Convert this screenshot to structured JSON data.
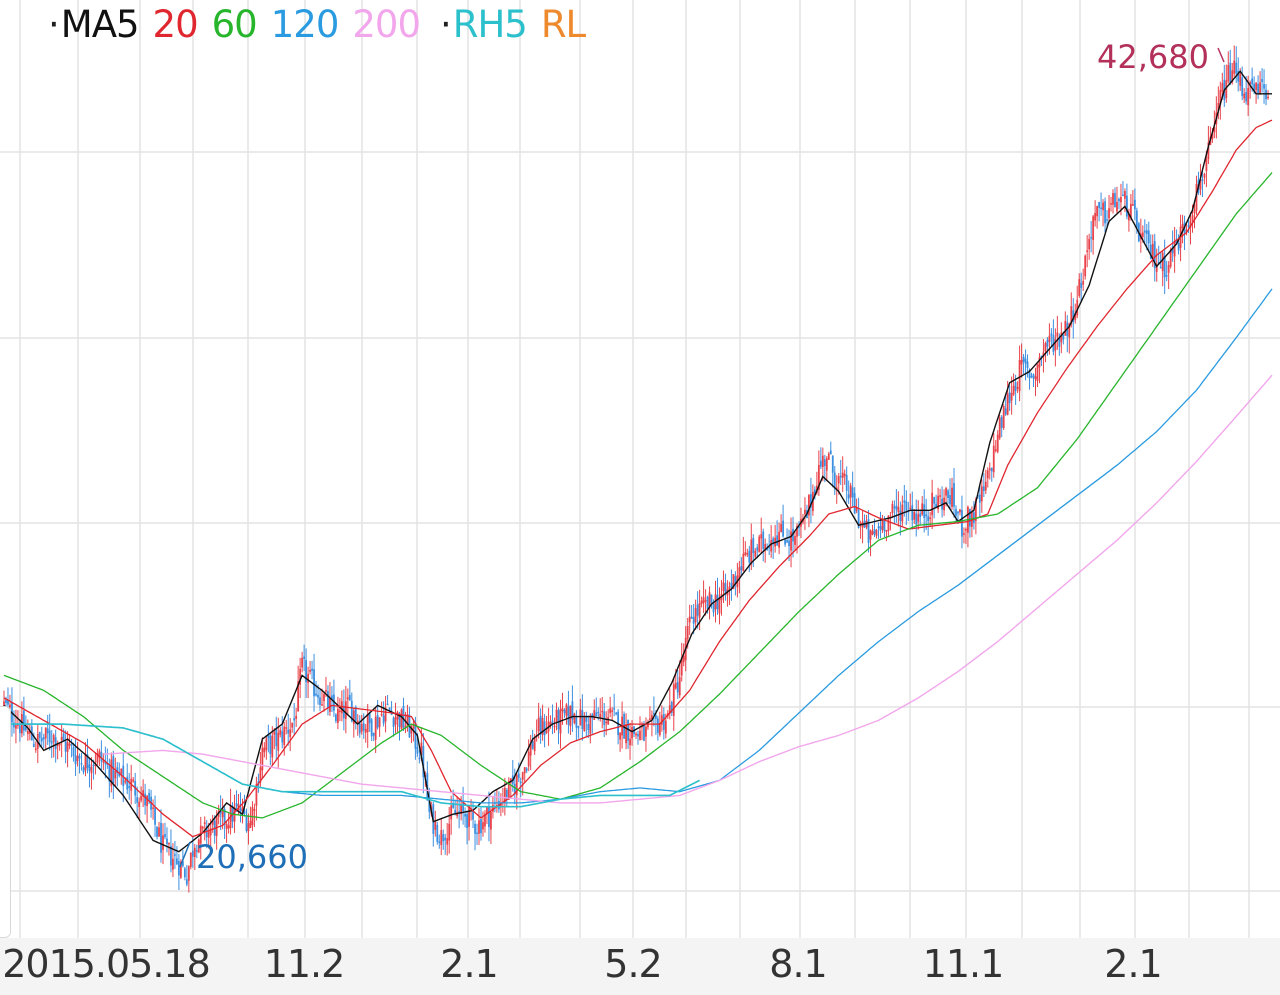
{
  "legend": {
    "dot1": "·",
    "ma5": "MA5",
    "ma20": "20",
    "ma60": "60",
    "ma120": "120",
    "ma200": "200",
    "dot2": "·",
    "rh5": "RH5",
    "rl": "RL"
  },
  "colors": {
    "ma5": "#111111",
    "ma20": "#e0262e",
    "ma60": "#27b52b",
    "ma120": "#2a9be0",
    "ma200": "#f2a6ec",
    "rh5": "#2cc0cc",
    "rl": "#ee8a2d",
    "candle_up": "#e8424a",
    "candle_down": "#3b8fe0",
    "high_label": "#b3305a",
    "low_label": "#1f6fb8",
    "grid": "#e3e3e3"
  },
  "annotations": {
    "high": "42,680",
    "low": "20,660"
  },
  "chart_data": {
    "type": "candlestick",
    "title": "",
    "xlabel": "",
    "ylabel": "",
    "x_tick_labels": [
      "2015.05.18",
      "11.2",
      "2.1",
      "5.2",
      "8.1",
      "11.1",
      "2.1"
    ],
    "ylim": [
      19000,
      44000
    ],
    "grid": true,
    "legend_placement": "top-left",
    "period_high": 42680,
    "period_low": 20660,
    "series": [
      {
        "name": "MA5",
        "anchors": [
          [
            0,
            25200
          ],
          [
            12,
            24600
          ],
          [
            20,
            24000
          ],
          [
            32,
            24300
          ],
          [
            45,
            23700
          ],
          [
            60,
            22800
          ],
          [
            75,
            21600
          ],
          [
            88,
            21300
          ],
          [
            100,
            21800
          ],
          [
            112,
            22600
          ],
          [
            120,
            22300
          ],
          [
            130,
            24300
          ],
          [
            140,
            24700
          ],
          [
            150,
            26000
          ],
          [
            160,
            25600
          ],
          [
            170,
            25100
          ],
          [
            178,
            24700
          ],
          [
            188,
            25200
          ],
          [
            200,
            24900
          ],
          [
            208,
            24400
          ],
          [
            216,
            22100
          ],
          [
            226,
            22300
          ],
          [
            236,
            22400
          ],
          [
            246,
            22900
          ],
          [
            256,
            23200
          ],
          [
            266,
            24300
          ],
          [
            276,
            24700
          ],
          [
            286,
            24900
          ],
          [
            296,
            24900
          ],
          [
            306,
            24800
          ],
          [
            316,
            24500
          ],
          [
            326,
            24800
          ],
          [
            336,
            25800
          ],
          [
            346,
            27100
          ],
          [
            356,
            27900
          ],
          [
            366,
            28300
          ],
          [
            376,
            29000
          ],
          [
            386,
            29500
          ],
          [
            396,
            29700
          ],
          [
            404,
            30300
          ],
          [
            412,
            31300
          ],
          [
            420,
            30900
          ],
          [
            430,
            30000
          ],
          [
            438,
            30100
          ],
          [
            446,
            30200
          ],
          [
            456,
            30400
          ],
          [
            466,
            30400
          ],
          [
            474,
            30600
          ],
          [
            480,
            30100
          ],
          [
            488,
            30400
          ],
          [
            496,
            32200
          ],
          [
            506,
            33800
          ],
          [
            516,
            34100
          ],
          [
            526,
            34700
          ],
          [
            536,
            35300
          ],
          [
            546,
            36400
          ],
          [
            556,
            38100
          ],
          [
            564,
            38500
          ],
          [
            572,
            37700
          ],
          [
            580,
            36900
          ],
          [
            590,
            37500
          ],
          [
            598,
            38400
          ],
          [
            606,
            40100
          ],
          [
            614,
            41600
          ],
          [
            622,
            42100
          ],
          [
            630,
            41500
          ],
          [
            638,
            41500
          ]
        ]
      },
      {
        "name": "20",
        "anchors": [
          [
            0,
            25400
          ],
          [
            20,
            24800
          ],
          [
            40,
            24200
          ],
          [
            60,
            23300
          ],
          [
            80,
            22300
          ],
          [
            95,
            21700
          ],
          [
            110,
            22000
          ],
          [
            122,
            22700
          ],
          [
            135,
            23600
          ],
          [
            150,
            24700
          ],
          [
            165,
            25200
          ],
          [
            180,
            25100
          ],
          [
            195,
            25000
          ],
          [
            205,
            24900
          ],
          [
            215,
            24000
          ],
          [
            225,
            22900
          ],
          [
            240,
            22200
          ],
          [
            256,
            22800
          ],
          [
            270,
            23600
          ],
          [
            285,
            24200
          ],
          [
            300,
            24500
          ],
          [
            315,
            24700
          ],
          [
            330,
            24700
          ],
          [
            345,
            25600
          ],
          [
            360,
            26900
          ],
          [
            375,
            28000
          ],
          [
            390,
            28900
          ],
          [
            405,
            29700
          ],
          [
            415,
            30300
          ],
          [
            428,
            30500
          ],
          [
            440,
            30200
          ],
          [
            455,
            29900
          ],
          [
            470,
            30000
          ],
          [
            485,
            30100
          ],
          [
            495,
            30300
          ],
          [
            505,
            31600
          ],
          [
            520,
            33000
          ],
          [
            535,
            34200
          ],
          [
            550,
            35300
          ],
          [
            565,
            36300
          ],
          [
            580,
            37200
          ],
          [
            595,
            37800
          ],
          [
            608,
            38900
          ],
          [
            620,
            40000
          ],
          [
            630,
            40600
          ],
          [
            638,
            40800
          ]
        ]
      },
      {
        "name": "60",
        "anchors": [
          [
            0,
            26000
          ],
          [
            20,
            25600
          ],
          [
            40,
            24900
          ],
          [
            60,
            24000
          ],
          [
            80,
            23300
          ],
          [
            100,
            22600
          ],
          [
            115,
            22300
          ],
          [
            130,
            22200
          ],
          [
            150,
            22600
          ],
          [
            170,
            23400
          ],
          [
            190,
            24200
          ],
          [
            205,
            24700
          ],
          [
            220,
            24400
          ],
          [
            240,
            23600
          ],
          [
            260,
            22900
          ],
          [
            280,
            22700
          ],
          [
            300,
            23000
          ],
          [
            320,
            23700
          ],
          [
            340,
            24500
          ],
          [
            360,
            25500
          ],
          [
            380,
            26600
          ],
          [
            400,
            27700
          ],
          [
            420,
            28700
          ],
          [
            440,
            29600
          ],
          [
            460,
            30000
          ],
          [
            480,
            30100
          ],
          [
            500,
            30300
          ],
          [
            520,
            31000
          ],
          [
            540,
            32300
          ],
          [
            560,
            33800
          ],
          [
            580,
            35300
          ],
          [
            600,
            36800
          ],
          [
            620,
            38300
          ],
          [
            638,
            39400
          ]
        ]
      },
      {
        "name": "120",
        "anchors": [
          [
            0,
            24700
          ],
          [
            30,
            24700
          ],
          [
            60,
            24600
          ],
          [
            80,
            24300
          ],
          [
            100,
            23700
          ],
          [
            120,
            23100
          ],
          [
            140,
            22900
          ],
          [
            160,
            22800
          ],
          [
            180,
            22800
          ],
          [
            200,
            22800
          ],
          [
            220,
            22700
          ],
          [
            240,
            22600
          ],
          [
            260,
            22600
          ],
          [
            280,
            22700
          ],
          [
            300,
            22900
          ],
          [
            320,
            23000
          ],
          [
            340,
            22900
          ],
          [
            360,
            23200
          ],
          [
            380,
            24000
          ],
          [
            400,
            25000
          ],
          [
            420,
            26000
          ],
          [
            440,
            26900
          ],
          [
            460,
            27700
          ],
          [
            480,
            28400
          ],
          [
            500,
            29200
          ],
          [
            520,
            30000
          ],
          [
            540,
            30800
          ],
          [
            560,
            31600
          ],
          [
            580,
            32500
          ],
          [
            600,
            33600
          ],
          [
            620,
            35000
          ],
          [
            638,
            36300
          ]
        ]
      },
      {
        "name": "200",
        "anchors": [
          [
            50,
            23900
          ],
          [
            80,
            24000
          ],
          [
            100,
            23900
          ],
          [
            120,
            23700
          ],
          [
            140,
            23500
          ],
          [
            160,
            23300
          ],
          [
            180,
            23100
          ],
          [
            200,
            23000
          ],
          [
            220,
            22900
          ],
          [
            240,
            22800
          ],
          [
            260,
            22700
          ],
          [
            280,
            22600
          ],
          [
            300,
            22600
          ],
          [
            320,
            22700
          ],
          [
            340,
            22800
          ],
          [
            360,
            23200
          ],
          [
            380,
            23700
          ],
          [
            400,
            24100
          ],
          [
            420,
            24400
          ],
          [
            440,
            24800
          ],
          [
            460,
            25400
          ],
          [
            480,
            26100
          ],
          [
            500,
            26900
          ],
          [
            520,
            27800
          ],
          [
            540,
            28700
          ],
          [
            560,
            29600
          ],
          [
            580,
            30600
          ],
          [
            600,
            31700
          ],
          [
            620,
            32900
          ],
          [
            638,
            34000
          ]
        ]
      },
      {
        "name": "RH5",
        "anchors": [
          [
            0,
            24700
          ],
          [
            30,
            24700
          ],
          [
            60,
            24600
          ],
          [
            80,
            24300
          ],
          [
            100,
            23700
          ],
          [
            120,
            23100
          ],
          [
            140,
            22900
          ],
          [
            170,
            22900
          ],
          [
            200,
            22900
          ],
          [
            220,
            22600
          ],
          [
            240,
            22500
          ],
          [
            260,
            22500
          ],
          [
            280,
            22700
          ],
          [
            300,
            22800
          ],
          [
            320,
            22800
          ],
          [
            335,
            22800
          ],
          [
            350,
            23200
          ]
        ]
      },
      {
        "name": "RL",
        "anchors": []
      }
    ]
  },
  "candles_close_path": [
    [
      0,
      25200
    ],
    [
      8,
      24700
    ],
    [
      16,
      24200
    ],
    [
      24,
      24400
    ],
    [
      32,
      24100
    ],
    [
      40,
      23700
    ],
    [
      48,
      23800
    ],
    [
      56,
      23300
    ],
    [
      64,
      23100
    ],
    [
      72,
      22600
    ],
    [
      80,
      21400
    ],
    [
      88,
      21000
    ],
    [
      92,
      20700
    ],
    [
      96,
      21600
    ],
    [
      104,
      21900
    ],
    [
      112,
      22200
    ],
    [
      118,
      22400
    ],
    [
      124,
      22100
    ],
    [
      130,
      24000
    ],
    [
      138,
      24300
    ],
    [
      146,
      24800
    ],
    [
      150,
      26200
    ],
    [
      156,
      25700
    ],
    [
      162,
      25300
    ],
    [
      168,
      24900
    ],
    [
      174,
      25200
    ],
    [
      180,
      24700
    ],
    [
      186,
      24700
    ],
    [
      192,
      25100
    ],
    [
      198,
      24900
    ],
    [
      204,
      24600
    ],
    [
      210,
      23900
    ],
    [
      214,
      22300
    ],
    [
      220,
      21700
    ],
    [
      226,
      22300
    ],
    [
      232,
      22300
    ],
    [
      238,
      22000
    ],
    [
      244,
      22300
    ],
    [
      250,
      22700
    ],
    [
      256,
      23000
    ],
    [
      262,
      23600
    ],
    [
      268,
      24500
    ],
    [
      274,
      24700
    ],
    [
      280,
      24800
    ],
    [
      286,
      25000
    ],
    [
      292,
      24700
    ],
    [
      298,
      24900
    ],
    [
      304,
      24900
    ],
    [
      310,
      24700
    ],
    [
      316,
      24500
    ],
    [
      322,
      24400
    ],
    [
      328,
      24700
    ],
    [
      334,
      24900
    ],
    [
      340,
      26000
    ],
    [
      346,
      27600
    ],
    [
      352,
      27800
    ],
    [
      358,
      28000
    ],
    [
      364,
      28200
    ],
    [
      370,
      28900
    ],
    [
      376,
      29300
    ],
    [
      382,
      29500
    ],
    [
      388,
      29800
    ],
    [
      394,
      29700
    ],
    [
      398,
      29600
    ],
    [
      404,
      30300
    ],
    [
      410,
      31500
    ],
    [
      414,
      31900
    ],
    [
      418,
      31300
    ],
    [
      424,
      31000
    ],
    [
      430,
      30200
    ],
    [
      436,
      29600
    ],
    [
      442,
      30100
    ],
    [
      448,
      30300
    ],
    [
      454,
      30600
    ],
    [
      460,
      30200
    ],
    [
      466,
      30500
    ],
    [
      472,
      30700
    ],
    [
      476,
      30800
    ],
    [
      482,
      30000
    ],
    [
      488,
      30300
    ],
    [
      494,
      31000
    ],
    [
      500,
      32400
    ],
    [
      506,
      33500
    ],
    [
      512,
      34200
    ],
    [
      518,
      34000
    ],
    [
      524,
      34800
    ],
    [
      530,
      35000
    ],
    [
      536,
      35400
    ],
    [
      542,
      36500
    ],
    [
      548,
      38200
    ],
    [
      554,
      38300
    ],
    [
      560,
      38700
    ],
    [
      566,
      38500
    ],
    [
      572,
      37700
    ],
    [
      578,
      37200
    ],
    [
      584,
      36900
    ],
    [
      590,
      37500
    ],
    [
      596,
      38200
    ],
    [
      602,
      39200
    ],
    [
      608,
      40200
    ],
    [
      612,
      41400
    ],
    [
      618,
      42200
    ],
    [
      624,
      41600
    ],
    [
      630,
      41500
    ],
    [
      636,
      41700
    ]
  ]
}
